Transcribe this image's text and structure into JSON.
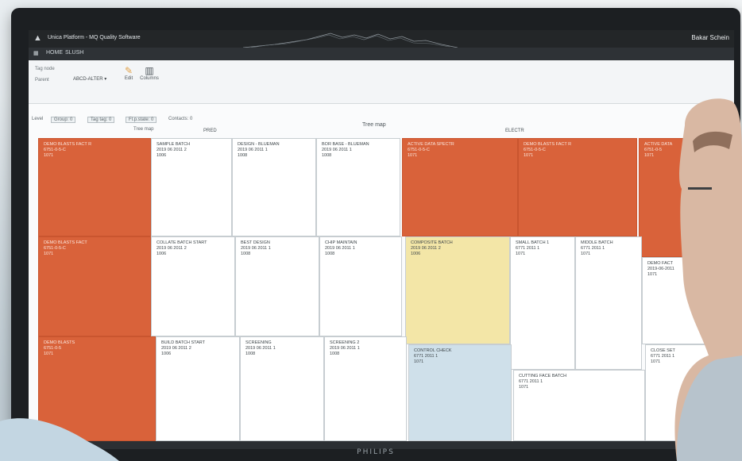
{
  "monitor": {
    "brand": "PHILIPS"
  },
  "titlebar": {
    "title": "Unica Platform - MQ Quality Software",
    "right": "Bakar Schein"
  },
  "menubar": {
    "items": [
      "HOME",
      "SLUSH"
    ]
  },
  "ribbon": {
    "field1": "Tag node",
    "field2": "Parent",
    "dropdown": "ABCD-ALTER",
    "edit_label": "Edit",
    "columns_label": "Columns"
  },
  "filters": {
    "items": [
      "Level",
      "Group: 0",
      "Tag tag: 0",
      "Fl.p.state: 0",
      "Contacts: 0"
    ],
    "tree_label": "Tree map"
  },
  "treemap_headers": {
    "left": "PRED",
    "center": "Tree map",
    "right": "ELECTR"
  },
  "tiles": [
    {
      "lines": [
        "DEMO BLASTS FACT R",
        "6751-0-5-C",
        "1071"
      ]
    },
    {
      "lines": [
        "SAMPLE BATCH",
        "2019 06 2011 2",
        "1006"
      ]
    },
    {
      "lines": [
        "DESIGN - BLUEMAN",
        "2019 06 2011 1",
        "1008"
      ]
    },
    {
      "lines": [
        "BOR BASE - BLUEMAN",
        "2019 06 2011 1",
        "1008"
      ]
    },
    {
      "lines": [
        "ACTIVE DATA SPECTR",
        "6751-0-5-C",
        "1071"
      ]
    },
    {
      "lines": [
        "DEMO BLASTS FACT R",
        "6751-0-5-C",
        "1071"
      ]
    },
    {
      "lines": [
        "ACTIVE DATA",
        "6751-0-5",
        "1071"
      ]
    },
    {
      "lines": [
        "DEMO BLASTS FACT",
        "6751-0-5-C",
        "1071"
      ]
    },
    {
      "lines": [
        "COLLATE BATCH START",
        "2019 06 2011 2",
        "1006"
      ]
    },
    {
      "lines": [
        "BEST DESIGN",
        "2019 06 2011 1",
        "1008"
      ]
    },
    {
      "lines": [
        "CHIP MAINTAIN",
        "2019 06 2011 1",
        "1008"
      ]
    },
    {
      "lines": [
        "COMPOSITE BATCH",
        "2019 06 2011 2",
        "1006"
      ]
    },
    {
      "lines": [
        "SMALL BATCH 1",
        "6771 2011 1",
        "1071"
      ]
    },
    {
      "lines": [
        "MIDDLE BATCH",
        "6771 2011 1",
        "1071"
      ]
    },
    {
      "lines": [
        "DEMO FACT",
        "2019-06-2011",
        "1071"
      ]
    },
    {
      "lines": [
        "DEMO BLASTS",
        "6751-0-5",
        "1071"
      ]
    },
    {
      "lines": [
        "BUILD BATCH START",
        "2019 06 2011 2",
        "1006"
      ]
    },
    {
      "lines": [
        "SCREENING",
        "2019 06 2011 1",
        "1008"
      ]
    },
    {
      "lines": [
        "SCREENING 2",
        "2019 06 2011 1",
        "1008"
      ]
    },
    {
      "lines": [
        "CONTROL CHECK",
        "6771 2011 1",
        "1071"
      ]
    },
    {
      "lines": [
        "CUTTING FACE BATCH",
        "6771 2011 1",
        "1071"
      ]
    },
    {
      "lines": [
        "CLOSE SET",
        "6771 2011 1",
        "1071"
      ]
    }
  ],
  "colors": {
    "orange": "#d9623a",
    "white": "#ffffff",
    "yellow": "#f3e6a7",
    "blue": "#cfe0ea",
    "titlebar": "#232628"
  },
  "icons": [
    "grid-icon",
    "pencil-icon",
    "columns-icon",
    "window-close-icon",
    "windows-logo-icon"
  ]
}
